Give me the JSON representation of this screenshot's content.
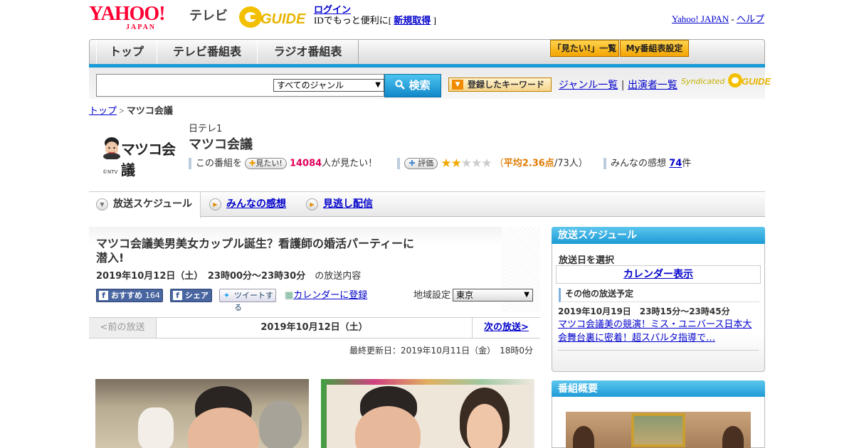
{
  "header": {
    "yahoo_logo": "YAHOO!",
    "yahoo_logo_sub": "JAPAN",
    "tv_label": "テレビ",
    "gguide_logo": "GUIDE",
    "login_link": "ログイン",
    "login_text": "IDでもっと便利に[ ",
    "register_link": "新規取得",
    "login_text_end": " ]",
    "yahoo_japan_link": "Yahoo! JAPAN",
    "separator": " - ",
    "help_link": "ヘルプ"
  },
  "nav": {
    "tabs": [
      {
        "label": "トップ"
      },
      {
        "label": "テレビ番組表"
      },
      {
        "label": "ラジオ番組表"
      }
    ],
    "mitai_list": "「見たい!」一覧",
    "my_schedule": "My番組表設定"
  },
  "search": {
    "genre_selected": "すべてのジャンル",
    "button_label": "検索",
    "keyword_button": "登録したキーワード",
    "genre_list_link": "ジャンル一覧",
    "pipe": " | ",
    "performers_link": "出演者一覧",
    "syndicated": "Syndicated"
  },
  "breadcrumb": {
    "top": "トップ",
    "sep": " > ",
    "current": "マツコ会議"
  },
  "program": {
    "logo_text": "マツコ会議",
    "logo_credit": "©NTV",
    "channel": "日テレ1",
    "title": "マツコ会議",
    "mitai_prefix": "この番組を",
    "mitai_pill": "見たい!",
    "mitai_count": "14084",
    "mitai_suffix": "人が見たい！",
    "rating_pill": "評価",
    "rating_open": "（",
    "rating_avg": "平均2.36点",
    "rating_count": "/73人）",
    "impressions_prefix": "みんなの感想 ",
    "impressions_count": "74",
    "impressions_suffix": "件",
    "rating_value": 2.36,
    "rating_max": 5
  },
  "tabs": {
    "schedule": "放送スケジュール",
    "impressions": "みんなの感想",
    "streaming": "見逃し配信"
  },
  "episode": {
    "title": "マツコ会議美男美女カップル誕生？看護師の婚活パーティーに潜入!",
    "date": "2019年10月12日（土）　23時00分～23時30分",
    "date_suffix": "の放送内容",
    "fb_recommend": "おすすめ",
    "fb_count": "164",
    "fb_share": "シェア",
    "tweet": "ツイートする",
    "calendar_link": "カレンダーに登録",
    "region_label": "地域設定",
    "region_selected": "東京",
    "prev": "<前の放送",
    "current_date": "2019年10月12日（土）",
    "next": "次の放送>",
    "updated": "最終更新日：2019年10月11日（金）　18時0分"
  },
  "sidebar": {
    "schedule_head": "放送スケジュール",
    "select_label": "放送日を選択",
    "calendar_link": "カレンダー表示",
    "other_label": "その他の放送予定",
    "other_date": "2019年10月19日　23時15分～23時45分",
    "other_link": "マツコ会議美の競演！ミス・ユニバース日本大会舞台裏に密着！超スパルタ指導で…",
    "overview_head": "番組概要"
  },
  "colors": {
    "accent_blue": "#1a9ad6",
    "yahoo_red": "#ff0033",
    "mitai_pink": "#e0005a",
    "star_gold": "#f0a800",
    "link_blue": "#0000cc"
  }
}
